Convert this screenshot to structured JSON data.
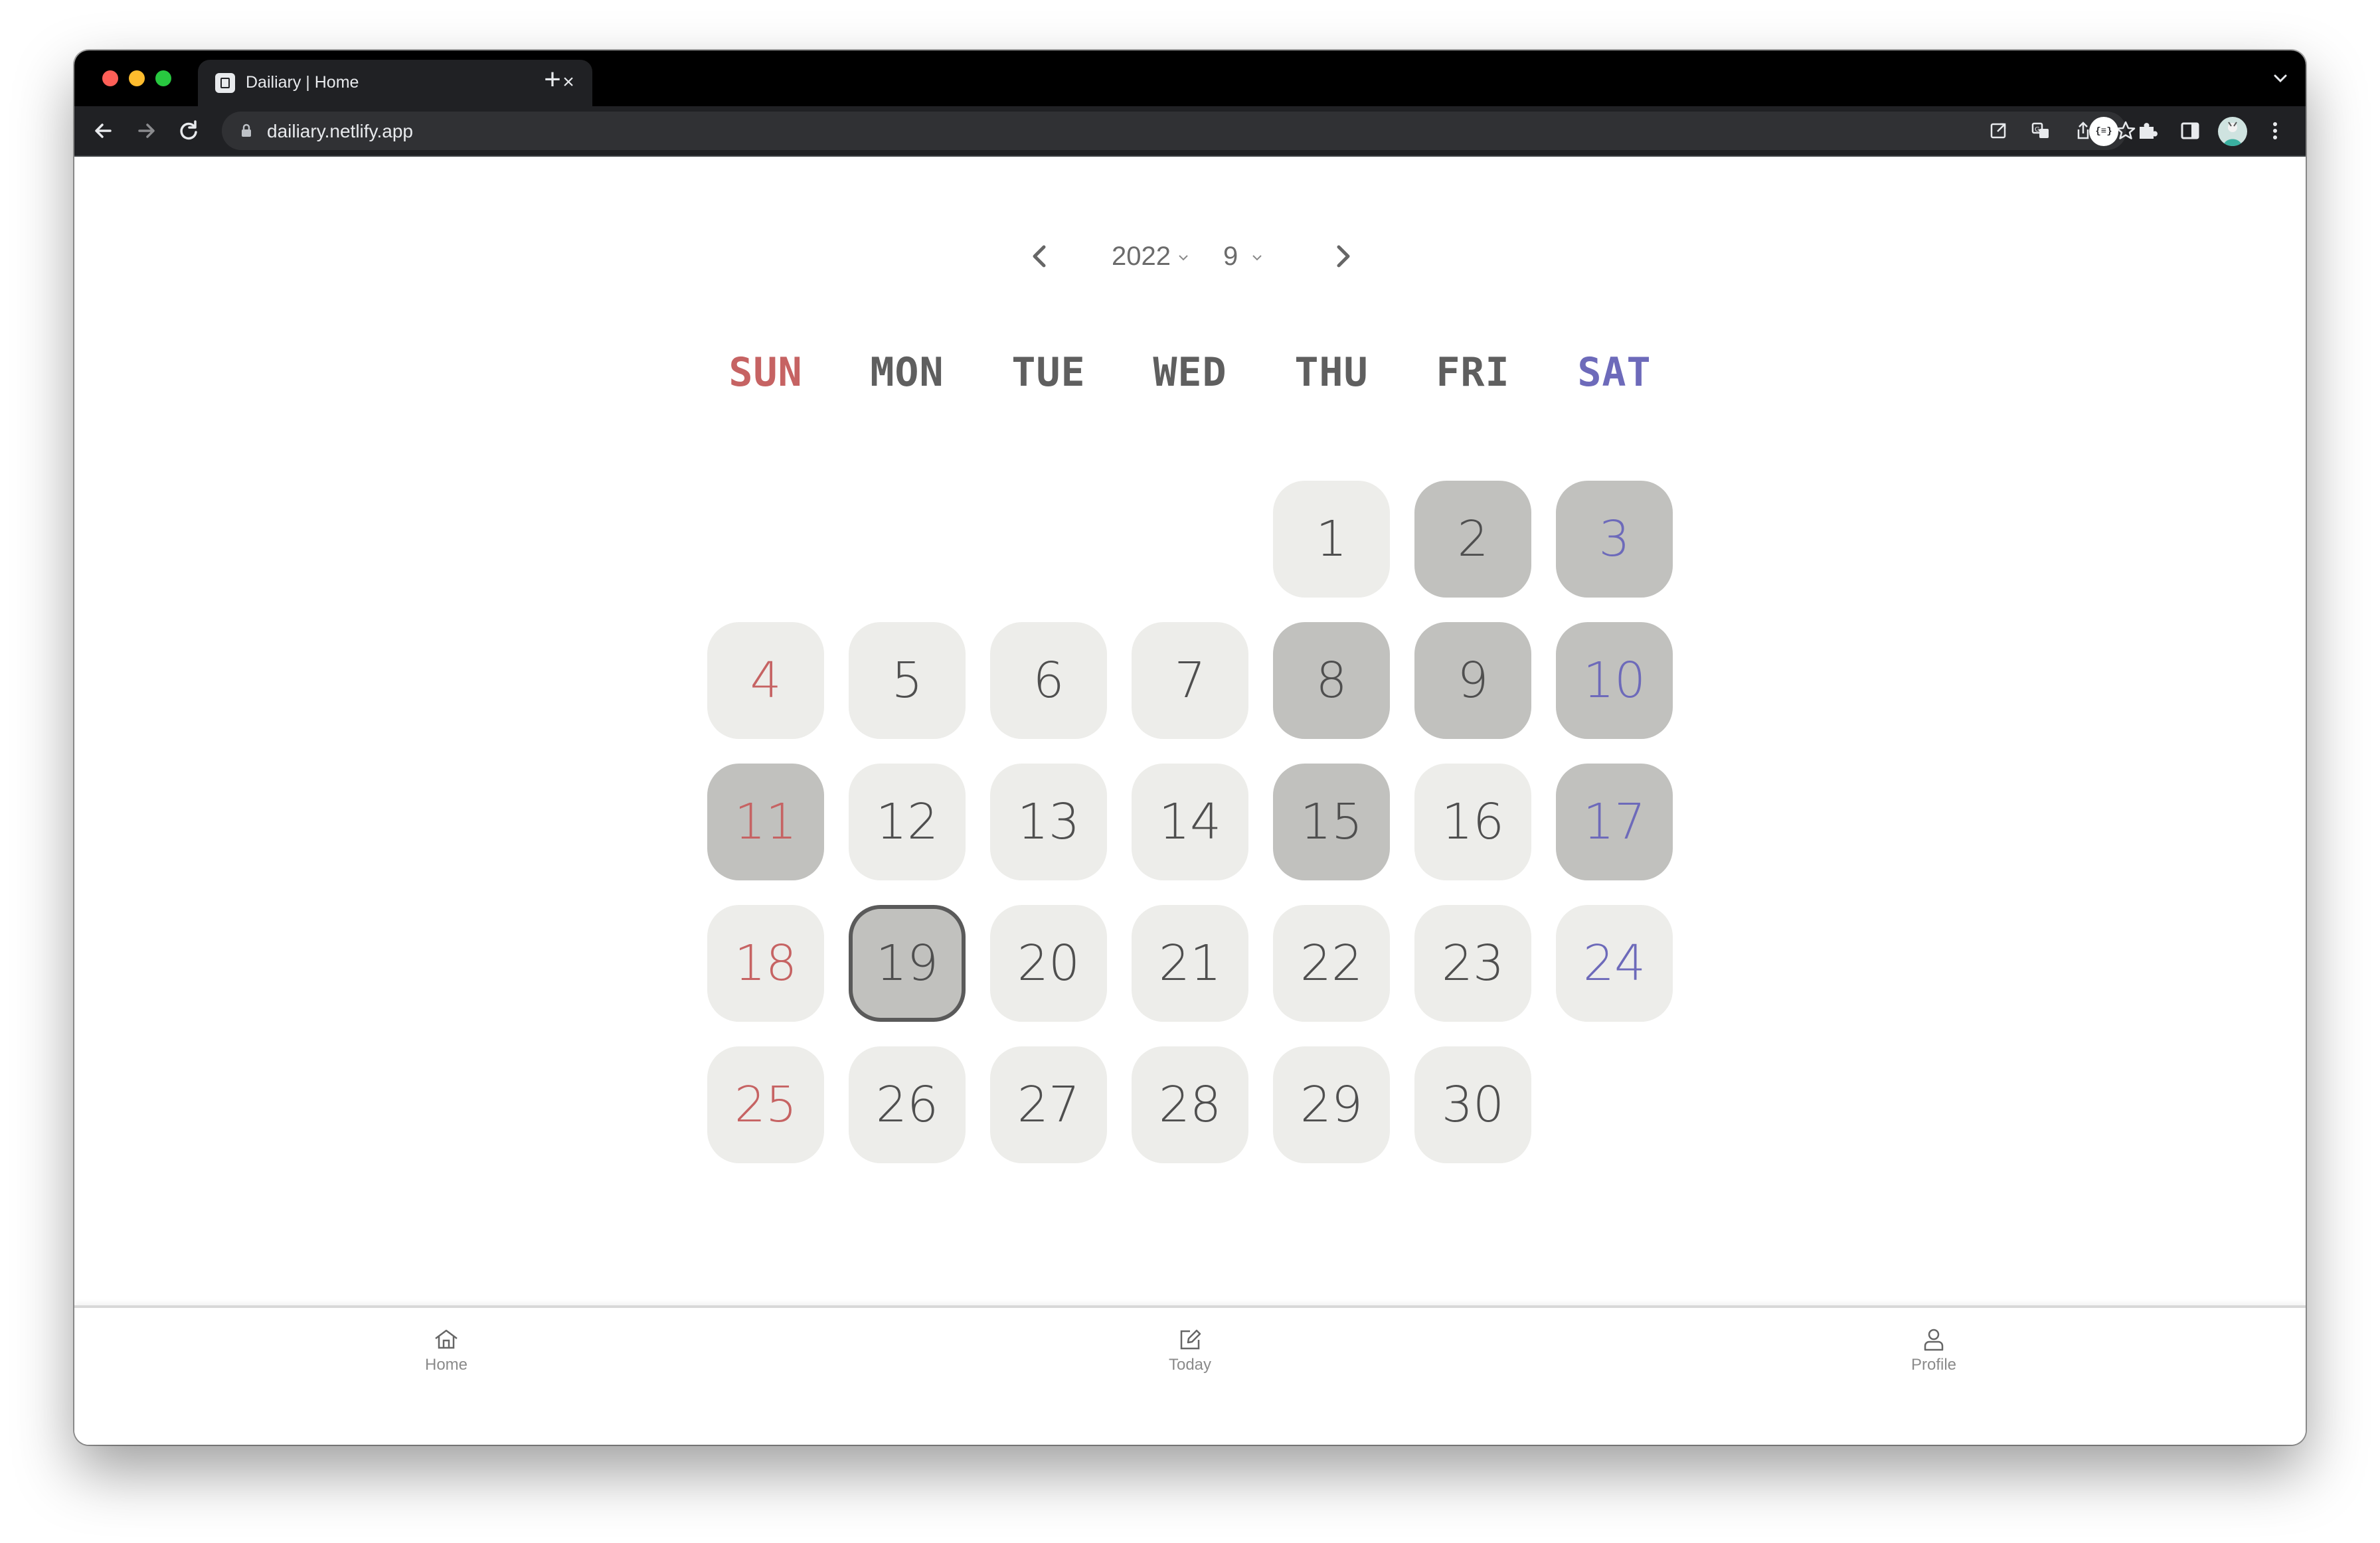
{
  "browser": {
    "tab_title": "Dailiary | Home",
    "tab_close": "×",
    "new_tab": "+",
    "url": "dailiary.netlify.app",
    "extension_badge": "{≡}"
  },
  "calendar": {
    "year": "2022",
    "month": "9",
    "weekdays": [
      "SUN",
      "MON",
      "TUE",
      "WED",
      "THU",
      "FRI",
      "SAT"
    ],
    "first_weekday_index": 4,
    "days_in_month": 30,
    "today": 19,
    "filled_days": [
      2,
      3,
      8,
      9,
      10,
      11,
      15,
      17,
      19
    ],
    "colors": {
      "sunday": "#c66363",
      "saturday": "#6d6aba",
      "weekday": "#4f4f4f",
      "day_bg": "#ededea",
      "filled_bg": "#c1c1be"
    }
  },
  "bottom_nav": {
    "items": [
      {
        "label": "Home",
        "icon": "home-icon"
      },
      {
        "label": "Today",
        "icon": "edit-icon"
      },
      {
        "label": "Profile",
        "icon": "person-icon"
      }
    ]
  }
}
